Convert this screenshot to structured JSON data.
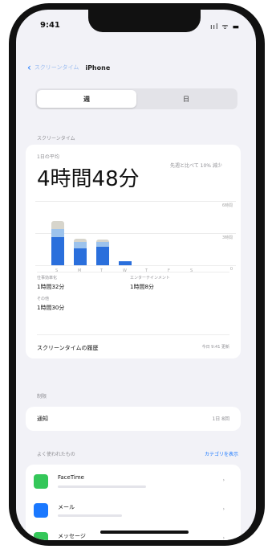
{
  "status_bar": {
    "time": "9:41",
    "icons": "ııl ᯤ ▬"
  },
  "nav": {
    "back_label": "スクリーンタイム",
    "title": "iPhone"
  },
  "segments": [
    {
      "label": "週"
    },
    {
      "label": "日"
    }
  ],
  "labels": {
    "section_usage": "スクリーンタイム",
    "daily_average": "1日の平均",
    "total_time": "4時間48分",
    "compare": "先週と比べて 10% 減少",
    "categories_1": "仕事効率化",
    "categories_1_value": "1時間32分",
    "categories_2": "エンターテインメント",
    "categories_2_value": "1時間8分",
    "categories_3": "その他",
    "categories_3_value": "1時間30分",
    "all_activity": "スクリーンタイムの履歴",
    "updated": "今日 9:41 更新",
    "section_limits": "制限",
    "limits_row_label": "通知",
    "limits_row_value": "1日 8回",
    "section_most_used": "よく使われたもの",
    "show_categories": "カテゴリを表示"
  },
  "chart_data": {
    "type": "bar",
    "categories": [
      "S",
      "M",
      "T",
      "W",
      "T",
      "F",
      "S"
    ],
    "series": [
      {
        "values": [
          2.6,
          1.6,
          1.7,
          0.4,
          0,
          0,
          0
        ]
      },
      {
        "values": [
          0.8,
          0.6,
          0.5,
          0.0,
          0,
          0,
          0
        ]
      },
      {
        "values": [
          0.7,
          0.3,
          0.2,
          0.0,
          0,
          0,
          0
        ]
      }
    ],
    "ylim": [
      0,
      6
    ],
    "yticks": [
      "6時間",
      "3時間",
      "0"
    ],
    "colors": [
      "#2a6fdc",
      "#9dc3ec",
      "#d7d5cc"
    ]
  },
  "apps": [
    {
      "name": "FaceTime",
      "time": "›",
      "icon_color": "#34c759",
      "icon": "video-icon",
      "bar_fraction": 0.55
    },
    {
      "name": "メール",
      "time": "›",
      "icon_color": "#1a78ff",
      "icon": "mail-icon",
      "bar_fraction": 0.4
    },
    {
      "name": "メッセージ",
      "time": "›",
      "icon_color": "#34c759",
      "icon": "messages-icon",
      "bar_fraction": 0.3
    }
  ]
}
